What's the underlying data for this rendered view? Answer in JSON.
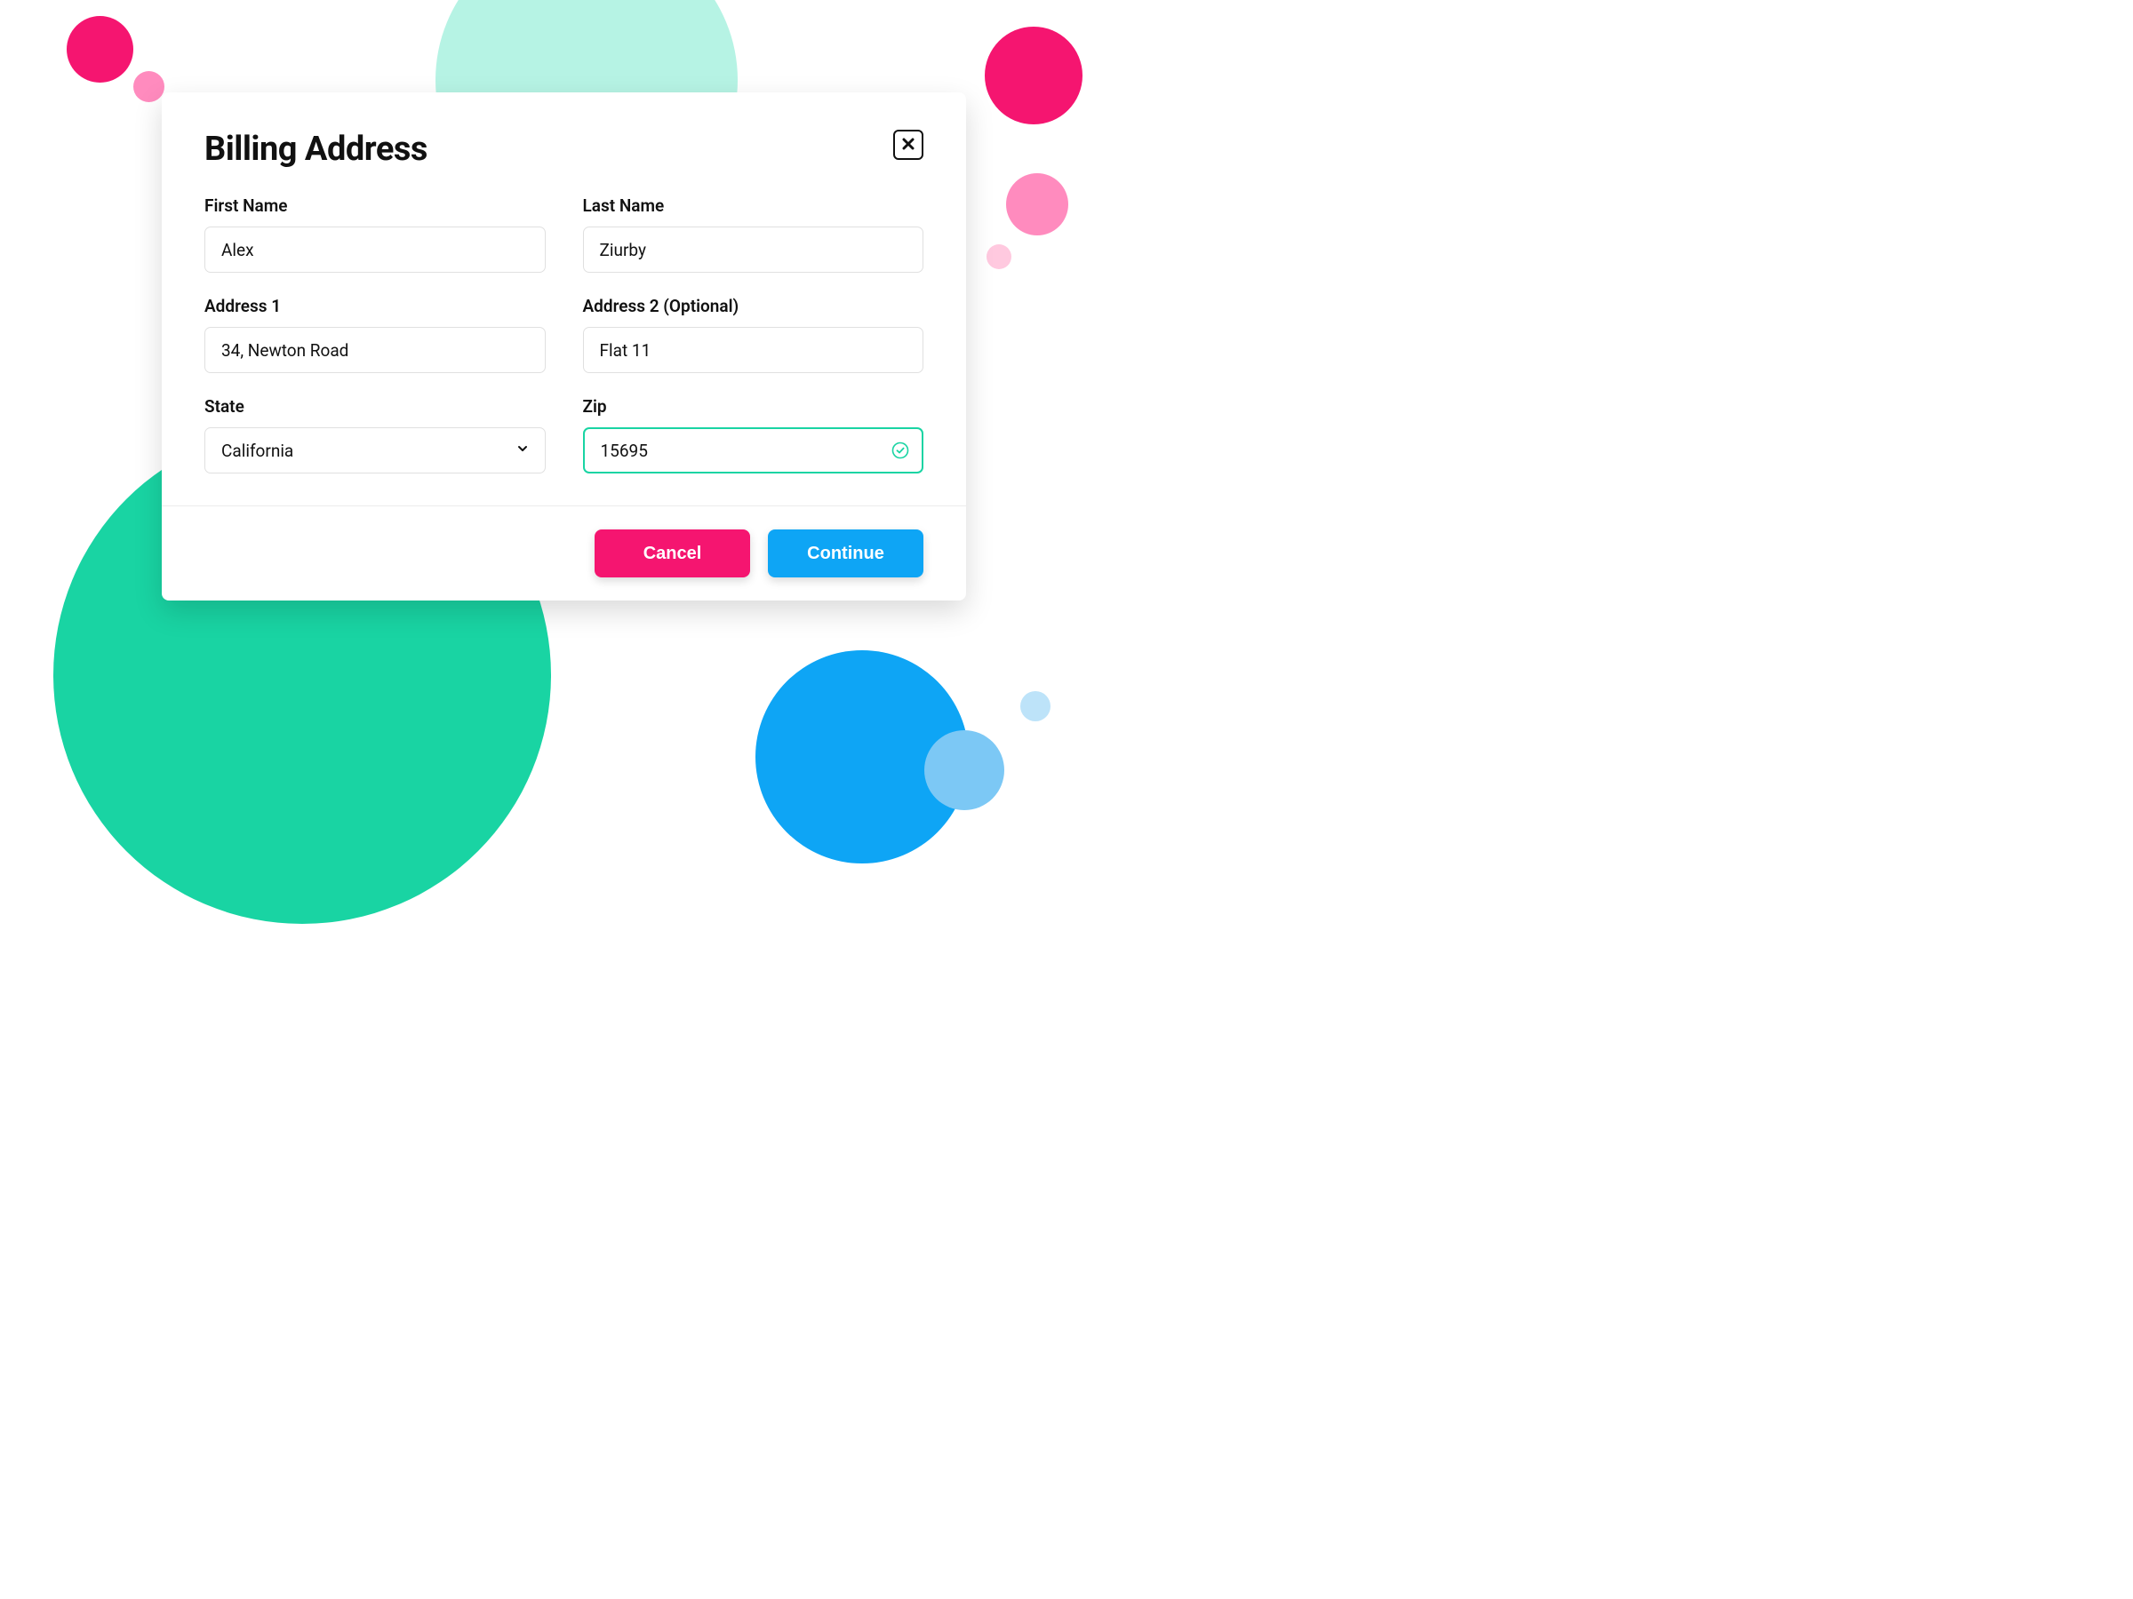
{
  "modal": {
    "title": "Billing Address",
    "fields": {
      "first_name": {
        "label": "First Name",
        "value": "Alex"
      },
      "last_name": {
        "label": "Last Name",
        "value": "Ziurby"
      },
      "address1": {
        "label": "Address 1",
        "value": "34, Newton Road"
      },
      "address2": {
        "label": "Address 2 (Optional)",
        "value": "Flat 11"
      },
      "state": {
        "label": "State",
        "value": "California"
      },
      "zip": {
        "label": "Zip",
        "value": "15695"
      }
    },
    "actions": {
      "cancel": "Cancel",
      "continue": "Continue"
    }
  },
  "colors": {
    "teal": "#19d4a3",
    "pink": "#f51570",
    "blue": "#0ea5f5"
  }
}
